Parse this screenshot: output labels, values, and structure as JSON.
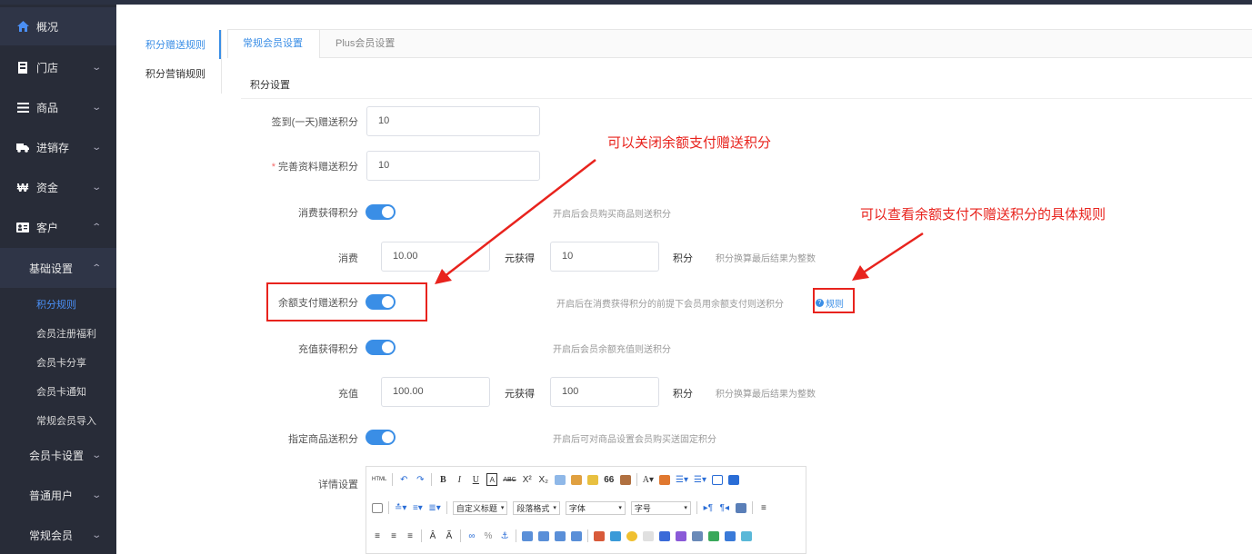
{
  "sidebar": {
    "home": "概况",
    "store": "门店",
    "goods": "商品",
    "inventory": "进销存",
    "funds": "资金",
    "customer": "客户",
    "basic_settings": "基础设置",
    "leaves": [
      "积分规则",
      "会员注册福利",
      "会员卡分享",
      "会员卡通知",
      "常规会员导入"
    ],
    "card_settings": "会员卡设置",
    "normal_users": "普通用户",
    "regular_members": "常规会员"
  },
  "subnav": {
    "items": [
      "积分赠送规则",
      "积分营销规则"
    ]
  },
  "tabs": [
    "常规会员设置",
    "Plus会员设置"
  ],
  "section_title": "积分设置",
  "form": {
    "signin": {
      "label": "签到(一天)赠送积分",
      "value": "10"
    },
    "profile": {
      "required_mark": "*",
      "label": "完善资料赠送积分",
      "value": "10"
    },
    "consume_toggle": {
      "label": "消费获得积分",
      "on": true,
      "hint": "开启后会员购买商品则送积分"
    },
    "consume_rate": {
      "label": "消费",
      "amount": "10.00",
      "mid": "元获得",
      "points": "10",
      "unit": "积分",
      "hint": "积分换算最后结果为整数"
    },
    "balance_toggle": {
      "label": "余额支付赠送积分",
      "on": true,
      "hint": "开启后在消费获得积分的前提下会员用余额支付则送积分",
      "rule_link": "规则"
    },
    "recharge_toggle": {
      "label": "充值获得积分",
      "on": true,
      "hint": "开启后会员余额充值则送积分"
    },
    "recharge_rate": {
      "label": "充值",
      "amount": "100.00",
      "mid": "元获得",
      "points": "100",
      "unit": "积分",
      "hint": "积分换算最后结果为整数"
    },
    "product_toggle": {
      "label": "指定商品送积分",
      "on": true,
      "hint": "开启后可对商品设置会员购买送固定积分"
    },
    "detail": {
      "label": "详情设置"
    }
  },
  "editor_toolbar": {
    "row1": [
      "HTML",
      "↶",
      "↷",
      "B",
      "I",
      "U",
      "A",
      "ABC",
      "X²",
      "X₂",
      "66"
    ],
    "selects": [
      "自定义标题",
      "段落格式",
      "字体",
      "字号"
    ]
  },
  "annotations": {
    "a1": "可以关闭余额支付赠送积分",
    "a2": "可以查看余额支付不赠送积分的具体规则"
  },
  "colors": {
    "accent": "#3a8ee6",
    "sidebar": "#282c38",
    "annotation": "#e8231d"
  }
}
